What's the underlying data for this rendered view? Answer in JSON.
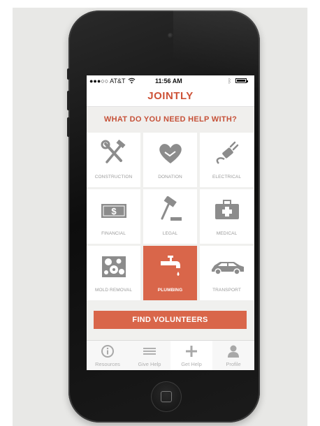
{
  "status_bar": {
    "carrier": "●●●○○ AT&T",
    "time": "11:56 AM"
  },
  "app": {
    "brand": "JOINTLY",
    "brand_color": "#cd5237",
    "accent_color": "#d9664a"
  },
  "main": {
    "heading": "WHAT DO YOU NEED HELP WITH?",
    "categories": [
      {
        "label": "CONSTRUCTION",
        "icon": "tools-icon",
        "selected": false
      },
      {
        "label": "DONATION",
        "icon": "heart-handshake-icon",
        "selected": false
      },
      {
        "label": "ELECTRICAL",
        "icon": "plug-icon",
        "selected": false
      },
      {
        "label": "FINANCIAL",
        "icon": "dollar-bill-icon",
        "selected": false
      },
      {
        "label": "LEGAL",
        "icon": "gavel-icon",
        "selected": false
      },
      {
        "label": "MEDICAL",
        "icon": "first-aid-kit-icon",
        "selected": false
      },
      {
        "label": "MOLD REMOVAL",
        "icon": "mold-icon",
        "selected": false
      },
      {
        "label": "PLUMBING",
        "icon": "faucet-icon",
        "selected": true
      },
      {
        "label": "TRANSPORT",
        "icon": "car-icon",
        "selected": false
      }
    ],
    "cta_label": "FIND VOLUNTEERS"
  },
  "tab_bar": {
    "tabs": [
      {
        "label": "Resources",
        "icon": "info-icon",
        "active": false
      },
      {
        "label": "Give Help",
        "icon": "list-icon",
        "active": false
      },
      {
        "label": "Get Help",
        "icon": "plus-icon",
        "active": true
      },
      {
        "label": "Profile",
        "icon": "person-icon",
        "active": false
      }
    ]
  }
}
